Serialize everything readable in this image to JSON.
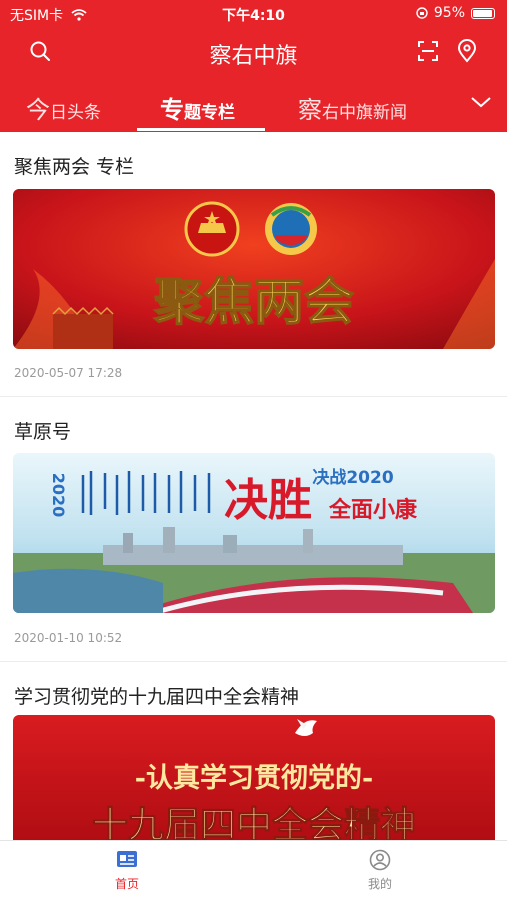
{
  "status_bar": {
    "carrier": "无SIM卡",
    "time": "下午4:10",
    "battery_text": "95%"
  },
  "header": {
    "title": "察右中旗"
  },
  "tabs": [
    {
      "first_char": "今",
      "rest": "日头条"
    },
    {
      "first_char": "专",
      "rest": "题专栏"
    },
    {
      "first_char": "察",
      "rest": "右中旗新闻"
    }
  ],
  "active_tab": 1,
  "sections": [
    {
      "title": "聚焦两会 专栏",
      "banner_text": "聚焦两会",
      "date": "2020-05-07 17:28"
    },
    {
      "title": "草原号",
      "banner_year": "2020",
      "banner_head": "决战2020",
      "banner_big": "决胜",
      "banner_sub": "全面小康",
      "date": "2020-01-10 10:52"
    },
    {
      "title": "学习贯彻党的十九届四中全会精神",
      "banner_line1": "-认真学习贯彻党的-",
      "banner_line2": "十九届四中全会精神"
    }
  ],
  "tabbar": {
    "home": "首页",
    "mine": "我的"
  },
  "colors": {
    "brand": "#e8242b",
    "gold": "#ffd55a",
    "tab_inactive": "#8a8a8a"
  }
}
